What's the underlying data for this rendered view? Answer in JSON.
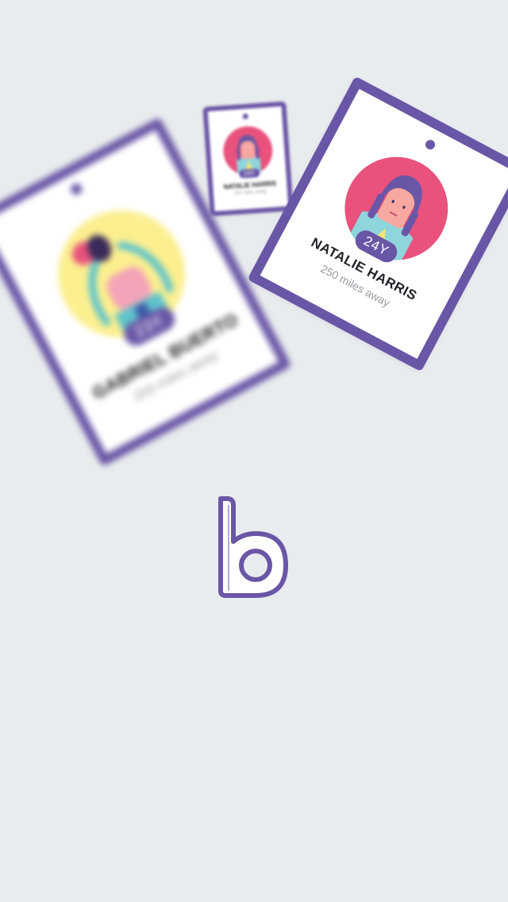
{
  "app": {
    "logo_letter": "b",
    "brand_color": "#6a56a6",
    "background_color": "#e9ecee"
  },
  "cards": [
    {
      "name": "GABRIEL BUERTO",
      "distance": "250 miles away",
      "age": "23Y",
      "avatar_icon": "man-with-heart-balloon-avatar",
      "avatar_bg": "#fbef8f",
      "blurred": true
    },
    {
      "name": "NATALIE HARRIS",
      "distance": "250 miles away",
      "age": "24Y",
      "avatar_icon": "woman-avatar",
      "avatar_bg": "#e8527c",
      "blurred": true
    },
    {
      "name": "NATALIE HARRIS",
      "distance": "250 miles away",
      "age": "24Y",
      "avatar_icon": "woman-avatar",
      "avatar_bg": "#e8527c",
      "blurred": false
    }
  ]
}
